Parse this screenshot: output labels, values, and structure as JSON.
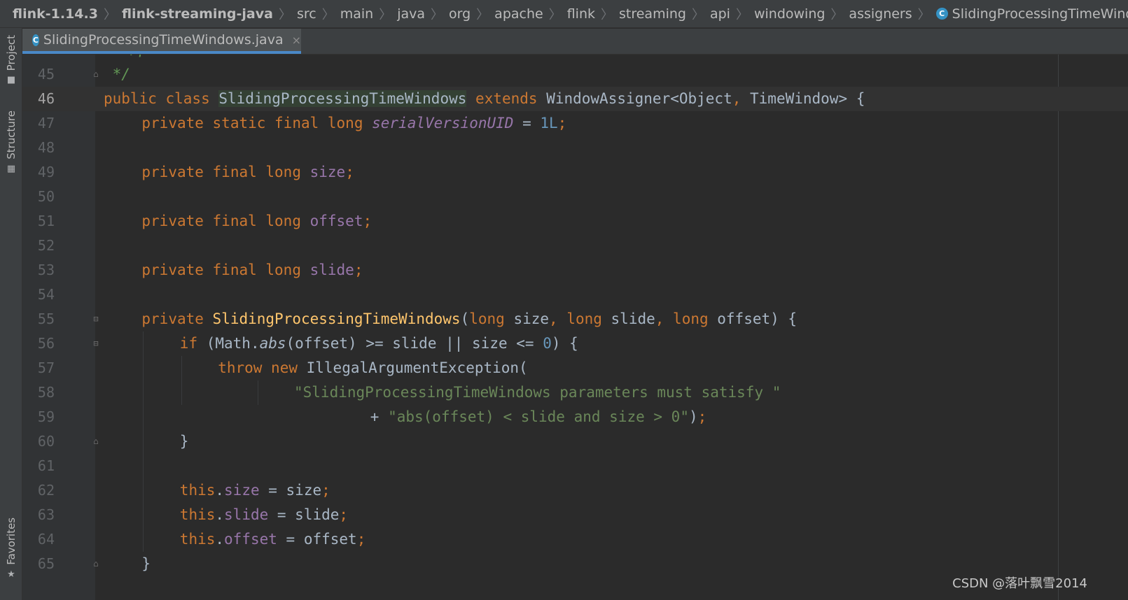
{
  "breadcrumb": {
    "items": [
      "flink-1.14.3",
      "flink-streaming-java",
      "src",
      "main",
      "java",
      "org",
      "apache",
      "flink",
      "streaming",
      "api",
      "windowing",
      "assigners",
      "SlidingProcessingTimeWindows"
    ],
    "class_icon_letter": "C"
  },
  "toolstrip": {
    "project_label": "Project",
    "structure_label": "Structure",
    "favorites_label": "Favorites"
  },
  "tabs": [
    {
      "label": "SlidingProcessingTimeWindows.java",
      "icon_letter": "C",
      "close_glyph": "×"
    }
  ],
  "editor": {
    "current_line": 46,
    "partial_line_text": "* </p>",
    "lines": [
      {
        "n": 45,
        "fold": "end",
        "indent": 0,
        "tokens": [
          {
            "t": " */",
            "c": "cmt"
          }
        ]
      },
      {
        "n": 46,
        "fold": "",
        "indent": 0,
        "tokens": [
          {
            "t": "public class ",
            "c": "kw"
          },
          {
            "t": "SlidingProcessingTimeWindows",
            "c": "hl"
          },
          {
            "t": " ",
            "c": ""
          },
          {
            "t": "extends ",
            "c": "kw"
          },
          {
            "t": "WindowAssigner<Object",
            "c": ""
          },
          {
            "t": ", ",
            "c": "kw"
          },
          {
            "t": "TimeWindow> {",
            "c": ""
          }
        ]
      },
      {
        "n": 47,
        "fold": "",
        "indent": 4,
        "tokens": [
          {
            "t": "private static final long ",
            "c": "kw"
          },
          {
            "t": "serialVersionUID",
            "c": "sfld"
          },
          {
            "t": " = ",
            "c": ""
          },
          {
            "t": "1L",
            "c": "num"
          },
          {
            "t": ";",
            "c": "kw"
          }
        ]
      },
      {
        "n": 48,
        "fold": "",
        "indent": 0,
        "tokens": []
      },
      {
        "n": 49,
        "fold": "",
        "indent": 4,
        "tokens": [
          {
            "t": "private final long ",
            "c": "kw"
          },
          {
            "t": "size",
            "c": "fld"
          },
          {
            "t": ";",
            "c": "kw"
          }
        ]
      },
      {
        "n": 50,
        "fold": "",
        "indent": 0,
        "tokens": []
      },
      {
        "n": 51,
        "fold": "",
        "indent": 4,
        "tokens": [
          {
            "t": "private final long ",
            "c": "kw"
          },
          {
            "t": "offset",
            "c": "fld"
          },
          {
            "t": ";",
            "c": "kw"
          }
        ]
      },
      {
        "n": 52,
        "fold": "",
        "indent": 0,
        "tokens": []
      },
      {
        "n": 53,
        "fold": "",
        "indent": 4,
        "tokens": [
          {
            "t": "private final long ",
            "c": "kw"
          },
          {
            "t": "slide",
            "c": "fld"
          },
          {
            "t": ";",
            "c": "kw"
          }
        ]
      },
      {
        "n": 54,
        "fold": "",
        "indent": 0,
        "tokens": []
      },
      {
        "n": 55,
        "fold": "start",
        "indent": 4,
        "tokens": [
          {
            "t": "private ",
            "c": "kw"
          },
          {
            "t": "SlidingProcessingTimeWindows",
            "c": "fn"
          },
          {
            "t": "(",
            "c": ""
          },
          {
            "t": "long ",
            "c": "kw"
          },
          {
            "t": "size",
            "c": ""
          },
          {
            "t": ", ",
            "c": "kw"
          },
          {
            "t": "long ",
            "c": "kw"
          },
          {
            "t": "slide",
            "c": ""
          },
          {
            "t": ", ",
            "c": "kw"
          },
          {
            "t": "long ",
            "c": "kw"
          },
          {
            "t": "offset) {",
            "c": ""
          }
        ]
      },
      {
        "n": 56,
        "fold": "start",
        "indent": 8,
        "tokens": [
          {
            "t": "if ",
            "c": "kw"
          },
          {
            "t": "(Math.",
            "c": ""
          },
          {
            "t": "abs",
            "c": "it"
          },
          {
            "t": "(offset) >= slide || size <= ",
            "c": ""
          },
          {
            "t": "0",
            "c": "num"
          },
          {
            "t": ") {",
            "c": ""
          }
        ]
      },
      {
        "n": 57,
        "fold": "",
        "indent": 12,
        "tokens": [
          {
            "t": "throw new ",
            "c": "kw"
          },
          {
            "t": "IllegalArgumentException(",
            "c": ""
          }
        ]
      },
      {
        "n": 58,
        "fold": "",
        "indent": 20,
        "tokens": [
          {
            "t": "\"SlidingProcessingTimeWindows parameters must satisfy \"",
            "c": "str"
          }
        ]
      },
      {
        "n": 59,
        "fold": "",
        "indent": 28,
        "tokens": [
          {
            "t": "+ ",
            "c": ""
          },
          {
            "t": "\"abs(offset) < slide and size > 0\"",
            "c": "str"
          },
          {
            "t": ")",
            "c": ""
          },
          {
            "t": ";",
            "c": "kw"
          }
        ]
      },
      {
        "n": 60,
        "fold": "end",
        "indent": 8,
        "tokens": [
          {
            "t": "}",
            "c": ""
          }
        ]
      },
      {
        "n": 61,
        "fold": "",
        "indent": 0,
        "tokens": []
      },
      {
        "n": 62,
        "fold": "",
        "indent": 8,
        "tokens": [
          {
            "t": "this",
            "c": "kw"
          },
          {
            "t": ".",
            "c": ""
          },
          {
            "t": "size",
            "c": "fld"
          },
          {
            "t": " = size",
            "c": ""
          },
          {
            "t": ";",
            "c": "kw"
          }
        ]
      },
      {
        "n": 63,
        "fold": "",
        "indent": 8,
        "tokens": [
          {
            "t": "this",
            "c": "kw"
          },
          {
            "t": ".",
            "c": ""
          },
          {
            "t": "slide",
            "c": "fld"
          },
          {
            "t": " = slide",
            "c": ""
          },
          {
            "t": ";",
            "c": "kw"
          }
        ]
      },
      {
        "n": 64,
        "fold": "",
        "indent": 8,
        "tokens": [
          {
            "t": "this",
            "c": "kw"
          },
          {
            "t": ".",
            "c": ""
          },
          {
            "t": "offset",
            "c": "fld"
          },
          {
            "t": " = offset",
            "c": ""
          },
          {
            "t": ";",
            "c": "kw"
          }
        ]
      },
      {
        "n": 65,
        "fold": "end",
        "indent": 4,
        "tokens": [
          {
            "t": "}",
            "c": ""
          }
        ]
      }
    ]
  },
  "watermark": "CSDN @落叶飘雪2014"
}
